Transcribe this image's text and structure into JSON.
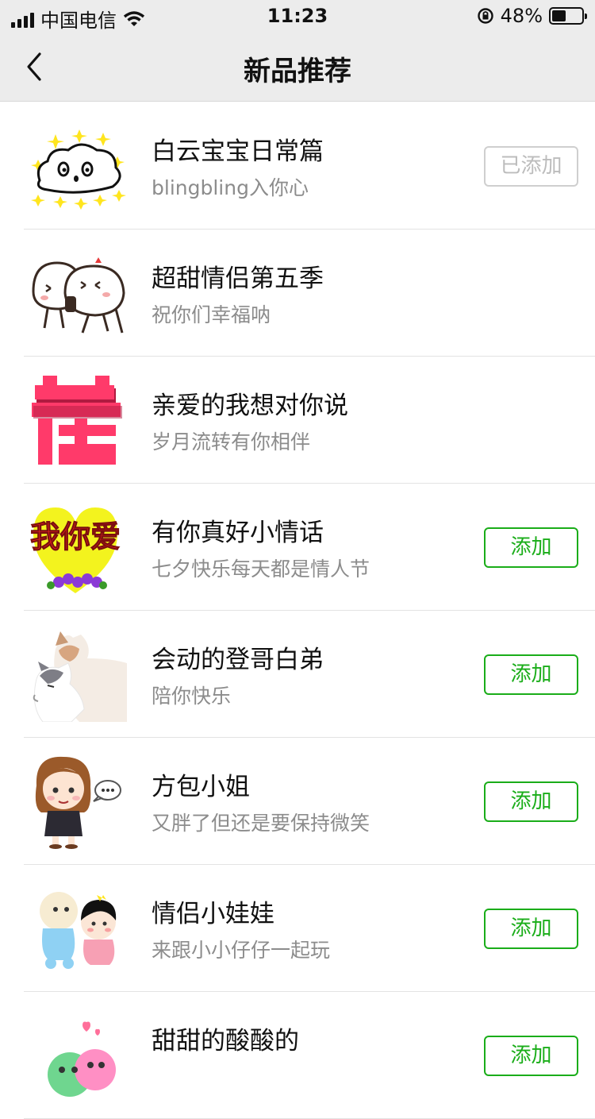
{
  "status_bar": {
    "carrier": "中国电信",
    "time": "11:23",
    "battery": "48%",
    "battery_level": 0.48
  },
  "nav": {
    "title": "新品推荐"
  },
  "items": [
    {
      "name": "白云宝宝日常篇",
      "desc": "blingbling入你心",
      "button": "已添加",
      "state": "added"
    },
    {
      "name": "超甜情侣第五季",
      "desc": "祝你们幸福呐",
      "button": "",
      "state": "none"
    },
    {
      "name": "亲爱的我想对你说",
      "desc": "岁月流转有你相伴",
      "button": "",
      "state": "none"
    },
    {
      "name": "有你真好小情话",
      "desc": "七夕快乐每天都是情人节",
      "button": "添加",
      "state": "add",
      "thumb_text": "我你爱"
    },
    {
      "name": "会动的登哥白弟",
      "desc": "陪你快乐",
      "button": "添加",
      "state": "add"
    },
    {
      "name": "方包小姐",
      "desc": "又胖了但还是要保持微笑",
      "button": "添加",
      "state": "add"
    },
    {
      "name": "情侣小娃娃",
      "desc": "来跟小小仔仔一起玩",
      "button": "添加",
      "state": "add"
    },
    {
      "name": "甜甜的酸酸的",
      "desc": "",
      "button": "添加",
      "state": "add"
    }
  ],
  "colors": {
    "accent": "#1aad19",
    "added_border": "#cfcfcf",
    "nav_bg": "#ececec"
  }
}
